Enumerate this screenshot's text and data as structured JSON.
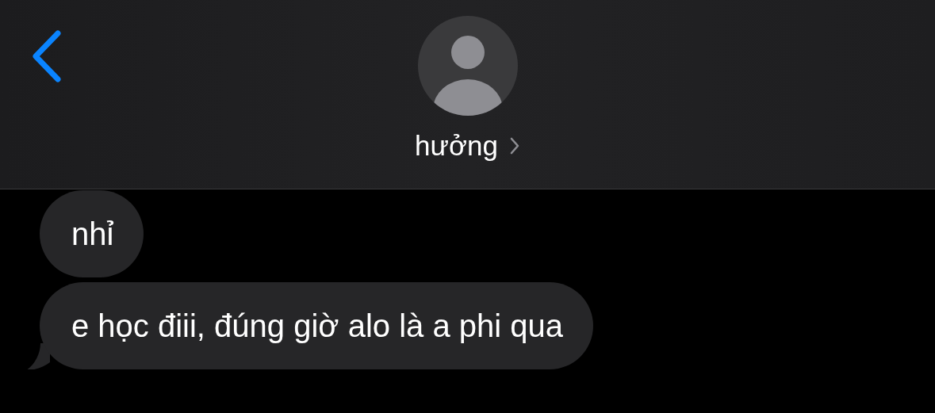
{
  "header": {
    "contact_name": "hưởng"
  },
  "messages": [
    {
      "text": "nhỉ",
      "tail": false
    },
    {
      "text": "e học điii, đúng giờ alo là a phi qua",
      "tail": true
    }
  ]
}
